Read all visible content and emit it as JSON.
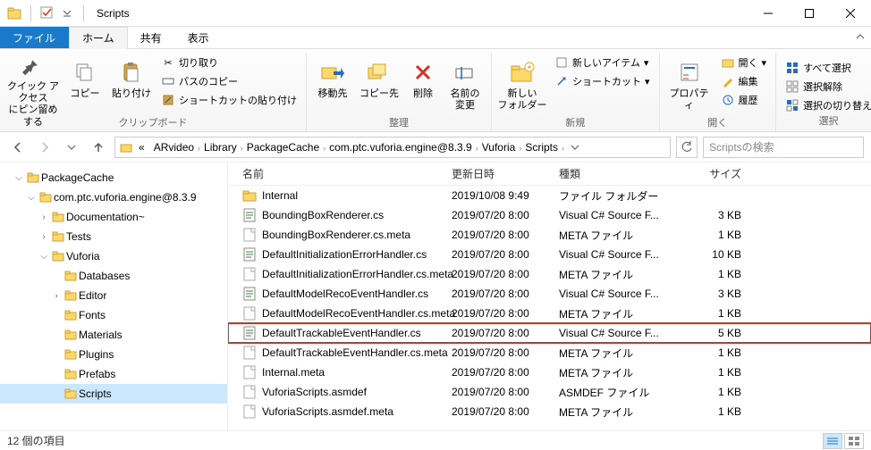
{
  "window": {
    "title": "Scripts"
  },
  "tabs": {
    "file": "ファイル",
    "home": "ホーム",
    "share": "共有",
    "view": "表示"
  },
  "ribbon": {
    "quick_access": "クイック アクセス\nにピン留めする",
    "copy": "コピー",
    "paste": "貼り付け",
    "cut": "切り取り",
    "copy_path": "パスのコピー",
    "paste_shortcut": "ショートカットの貼り付け",
    "clipboard_label": "クリップボード",
    "move_to": "移動先",
    "copy_to": "コピー先",
    "delete": "削除",
    "rename": "名前の\n変更",
    "organize_label": "整理",
    "new_folder": "新しい\nフォルダー",
    "new_item": "新しいアイテム",
    "shortcut": "ショートカット",
    "new_label": "新規",
    "properties": "プロパティ",
    "open": "開く",
    "edit": "編集",
    "history": "履歴",
    "open_label": "開く",
    "select_all": "すべて選択",
    "select_none": "選択解除",
    "invert": "選択の切り替え",
    "select_label": "選択"
  },
  "breadcrumbs": [
    "ARvideo",
    "Library",
    "PackageCache",
    "com.ptc.vuforia.engine@8.3.9",
    "Vuforia",
    "Scripts"
  ],
  "search_placeholder": "Scriptsの検索",
  "tree": [
    {
      "d": 0,
      "exp": "▾",
      "label": "PackageCache"
    },
    {
      "d": 1,
      "exp": "▾",
      "label": "com.ptc.vuforia.engine@8.3.9"
    },
    {
      "d": 2,
      "exp": "▸",
      "label": "Documentation~"
    },
    {
      "d": 2,
      "exp": "▸",
      "label": "Tests"
    },
    {
      "d": 2,
      "exp": "▾",
      "label": "Vuforia"
    },
    {
      "d": 3,
      "exp": "",
      "label": "Databases"
    },
    {
      "d": 3,
      "exp": "▸",
      "label": "Editor"
    },
    {
      "d": 3,
      "exp": "",
      "label": "Fonts"
    },
    {
      "d": 3,
      "exp": "",
      "label": "Materials"
    },
    {
      "d": 3,
      "exp": "",
      "label": "Plugins"
    },
    {
      "d": 3,
      "exp": "",
      "label": "Prefabs"
    },
    {
      "d": 3,
      "exp": "",
      "label": "Scripts",
      "selected": true
    }
  ],
  "columns": {
    "name": "名前",
    "date": "更新日時",
    "type": "種類",
    "size": "サイズ"
  },
  "rows": [
    {
      "icon": "folder",
      "name": "Internal",
      "date": "2019/10/08 9:49",
      "type": "ファイル フォルダー",
      "size": ""
    },
    {
      "icon": "cs",
      "name": "BoundingBoxRenderer.cs",
      "date": "2019/07/20 8:00",
      "type": "Visual C# Source F...",
      "size": "3 KB"
    },
    {
      "icon": "file",
      "name": "BoundingBoxRenderer.cs.meta",
      "date": "2019/07/20 8:00",
      "type": "META ファイル",
      "size": "1 KB"
    },
    {
      "icon": "cs",
      "name": "DefaultInitializationErrorHandler.cs",
      "date": "2019/07/20 8:00",
      "type": "Visual C# Source F...",
      "size": "10 KB"
    },
    {
      "icon": "file",
      "name": "DefaultInitializationErrorHandler.cs.meta",
      "date": "2019/07/20 8:00",
      "type": "META ファイル",
      "size": "1 KB"
    },
    {
      "icon": "cs",
      "name": "DefaultModelRecoEventHandler.cs",
      "date": "2019/07/20 8:00",
      "type": "Visual C# Source F...",
      "size": "3 KB"
    },
    {
      "icon": "file",
      "name": "DefaultModelRecoEventHandler.cs.meta",
      "date": "2019/07/20 8:00",
      "type": "META ファイル",
      "size": "1 KB"
    },
    {
      "icon": "cs",
      "name": "DefaultTrackableEventHandler.cs",
      "date": "2019/07/20 8:00",
      "type": "Visual C# Source F...",
      "size": "5 KB",
      "hl": true
    },
    {
      "icon": "file",
      "name": "DefaultTrackableEventHandler.cs.meta",
      "date": "2019/07/20 8:00",
      "type": "META ファイル",
      "size": "1 KB"
    },
    {
      "icon": "file",
      "name": "Internal.meta",
      "date": "2019/07/20 8:00",
      "type": "META ファイル",
      "size": "1 KB"
    },
    {
      "icon": "file",
      "name": "VuforiaScripts.asmdef",
      "date": "2019/07/20 8:00",
      "type": "ASMDEF ファイル",
      "size": "1 KB"
    },
    {
      "icon": "file",
      "name": "VuforiaScripts.asmdef.meta",
      "date": "2019/07/20 8:00",
      "type": "META ファイル",
      "size": "1 KB"
    }
  ],
  "status": "12 個の項目"
}
